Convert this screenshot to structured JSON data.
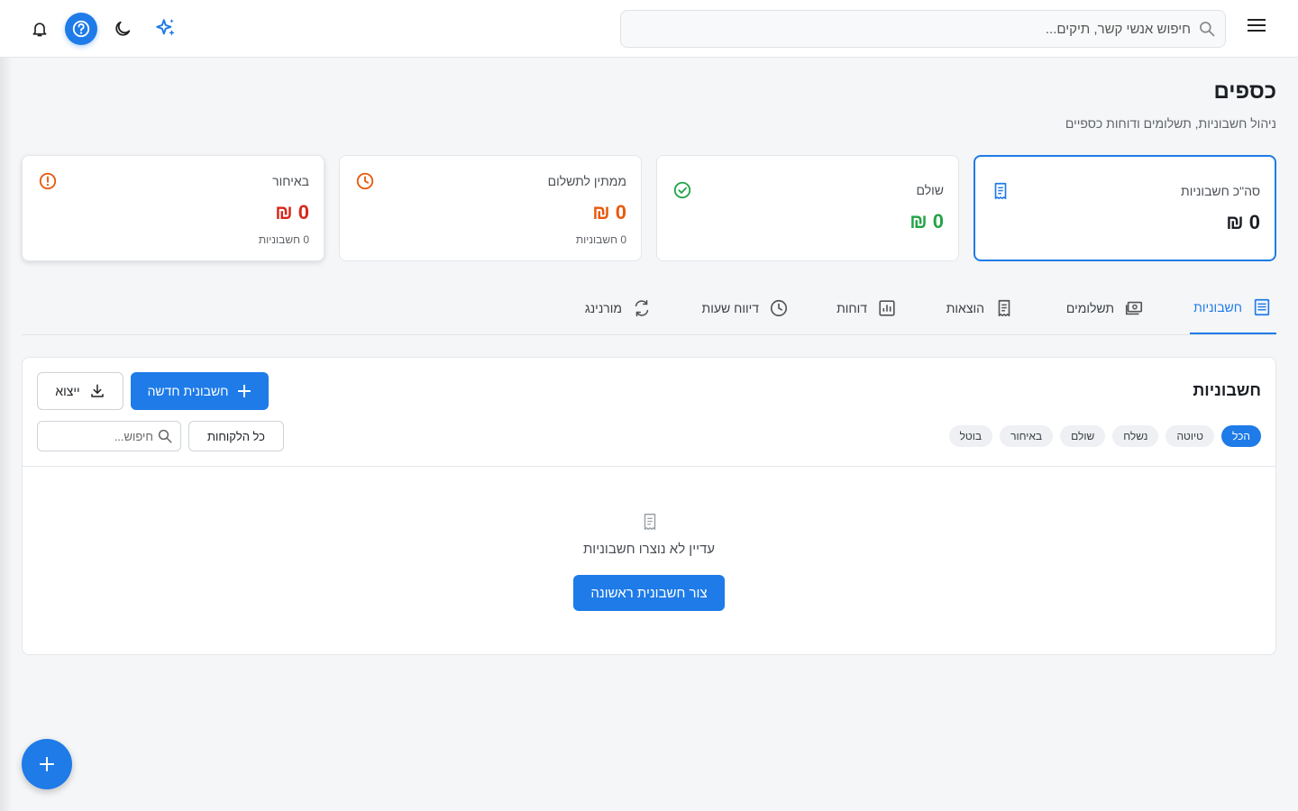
{
  "topbar": {
    "search_placeholder": "חיפוש אנשי קשר, תיקים..."
  },
  "header": {
    "title": "כספים",
    "subtitle": "ניהול חשבוניות, תשלומים ודוחות כספיים"
  },
  "stats": [
    {
      "label": "סה\"כ חשבוניות",
      "amount": "0 ₪",
      "count": "",
      "color": "#1b1f24",
      "icon": "receipt-icon"
    },
    {
      "label": "שולם",
      "amount": "0 ₪",
      "count": "",
      "color": "#22a447",
      "icon": "check-circle-icon"
    },
    {
      "label": "ממתין לתשלום",
      "amount": "0 ₪",
      "count": "0 חשבוניות",
      "color": "#e8590c",
      "icon": "clock-icon"
    },
    {
      "label": "באיחור",
      "amount": "0 ₪",
      "count": "0 חשבוניות",
      "color": "#d9261c",
      "icon": "alert-circle-icon"
    }
  ],
  "tabs": [
    {
      "label": "חשבוניות",
      "icon": "list-icon"
    },
    {
      "label": "תשלומים",
      "icon": "payments-icon"
    },
    {
      "label": "הוצאות",
      "icon": "receipt-icon"
    },
    {
      "label": "דוחות",
      "icon": "bar-chart-icon"
    },
    {
      "label": "דיווח שעות",
      "icon": "clock-icon"
    },
    {
      "label": "מורנינג",
      "icon": "sync-icon"
    }
  ],
  "invoices": {
    "title": "חשבוניות",
    "new_button": "חשבונית חדשה",
    "export_button": "ייצוא",
    "filters": [
      "הכל",
      "טיוטה",
      "נשלח",
      "שולם",
      "באיחור",
      "בוטל"
    ],
    "client_select": "כל הלקוחות",
    "search_placeholder": "חיפוש...",
    "empty_text": "עדיין לא נוצרו חשבוניות",
    "create_first": "צור חשבונית ראשונה"
  },
  "colors": {
    "accent": "#1e7be8",
    "paid": "#22a447",
    "pending": "#e8590c",
    "overdue": "#d9261c"
  }
}
